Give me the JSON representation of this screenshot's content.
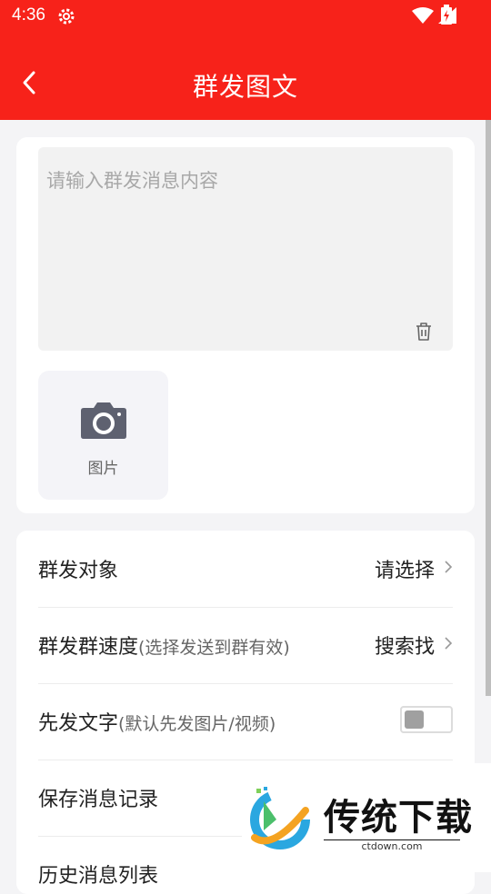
{
  "status_bar": {
    "time": "4:36"
  },
  "app_bar": {
    "title": "群发图文"
  },
  "message": {
    "placeholder": "请输入群发消息内容",
    "value": ""
  },
  "image_picker": {
    "label": "图片"
  },
  "settings": {
    "rows": [
      {
        "label": "群发对象",
        "hint": "",
        "value": "请选择"
      },
      {
        "label": "群发群速度",
        "hint": "(选择发送到群有效)",
        "value": "搜索找"
      },
      {
        "label": "先发文字",
        "hint": "(默认先发图片/视频)",
        "toggle_on": false
      },
      {
        "label": "保存消息记录",
        "hint": ""
      },
      {
        "label": "历史消息列表",
        "hint": ""
      }
    ]
  },
  "watermark": {
    "brand": "传统下载",
    "url": "ctdown.com"
  },
  "colors": {
    "accent": "#f7221a",
    "background": "#f4f4f6"
  },
  "icons": [
    "gear-icon",
    "wifi-icon",
    "signal-icon",
    "battery-icon",
    "back-arrow-icon",
    "trash-icon",
    "camera-icon",
    "chevron-right-icon"
  ]
}
